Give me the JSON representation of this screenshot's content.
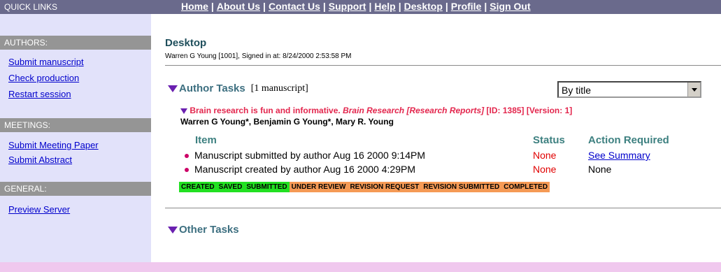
{
  "sidebar": {
    "quick_links_title": "QUICK LINKS",
    "authors": {
      "title": "AUTHORS:",
      "links": [
        "Submit manuscript",
        "Check production",
        "Restart session"
      ]
    },
    "meetings": {
      "title": "MEETINGS:",
      "links": [
        "Submit Meeting Paper",
        "Submit Abstract"
      ]
    },
    "general": {
      "title": "GENERAL:",
      "links": [
        "Preview Server"
      ]
    }
  },
  "topnav": {
    "items": [
      "Home",
      "About Us",
      "Contact Us",
      "Support",
      "Help",
      "Desktop",
      "Profile",
      "Sign Out"
    ],
    "separator": "|"
  },
  "main": {
    "title": "Desktop",
    "signin": "Warren G Young [1001], Signed in at: 8/24/2000 2:53:58 PM",
    "author_tasks": {
      "title": "Author Tasks",
      "count": "[1 manuscript]",
      "sort_value": "By title"
    },
    "manuscript": {
      "title": "Brain research is fun and informative.",
      "journal": "Brain Research [Research Reports]",
      "id": "[ID: 1385]",
      "version": "[Version: 1]",
      "authors": "Warren G Young*, Benjamin G Young*, Mary R. Young"
    },
    "columns": {
      "item": "Item",
      "status": "Status",
      "action": "Action Required"
    },
    "rows": [
      {
        "item": "Manuscript submitted by author Aug 16 2000 9:14PM",
        "status": "None",
        "action": "See Summary"
      },
      {
        "item": "Manuscript created by author Aug 16 2000 4:29PM",
        "status": "None",
        "action": "None"
      }
    ],
    "status_strip": [
      {
        "label": "CREATED",
        "done": true
      },
      {
        "label": "SAVED",
        "done": true
      },
      {
        "label": "SUBMITTED",
        "done": true
      },
      {
        "label": "UNDER REVIEW",
        "done": false
      },
      {
        "label": "REVISION REQUEST",
        "done": false
      },
      {
        "label": "REVISION SUBMITTED",
        "done": false
      },
      {
        "label": "COMPLETED",
        "done": false
      }
    ],
    "other_tasks": {
      "title": "Other Tasks"
    }
  },
  "colors": {
    "nav_bar": "#6a6a8c",
    "sidebar_bg": "#e2e2fa",
    "section_header": "#959595",
    "stage_done": "#22e022",
    "stage_pending": "#f59a55",
    "manuscript_title": "#e3264d",
    "footer": "#f0c8ee"
  },
  "icons": {
    "section_toggle": "triangle-down-icon",
    "row_marker": "bullet-icon",
    "dropdown": "chevron-down-icon"
  }
}
